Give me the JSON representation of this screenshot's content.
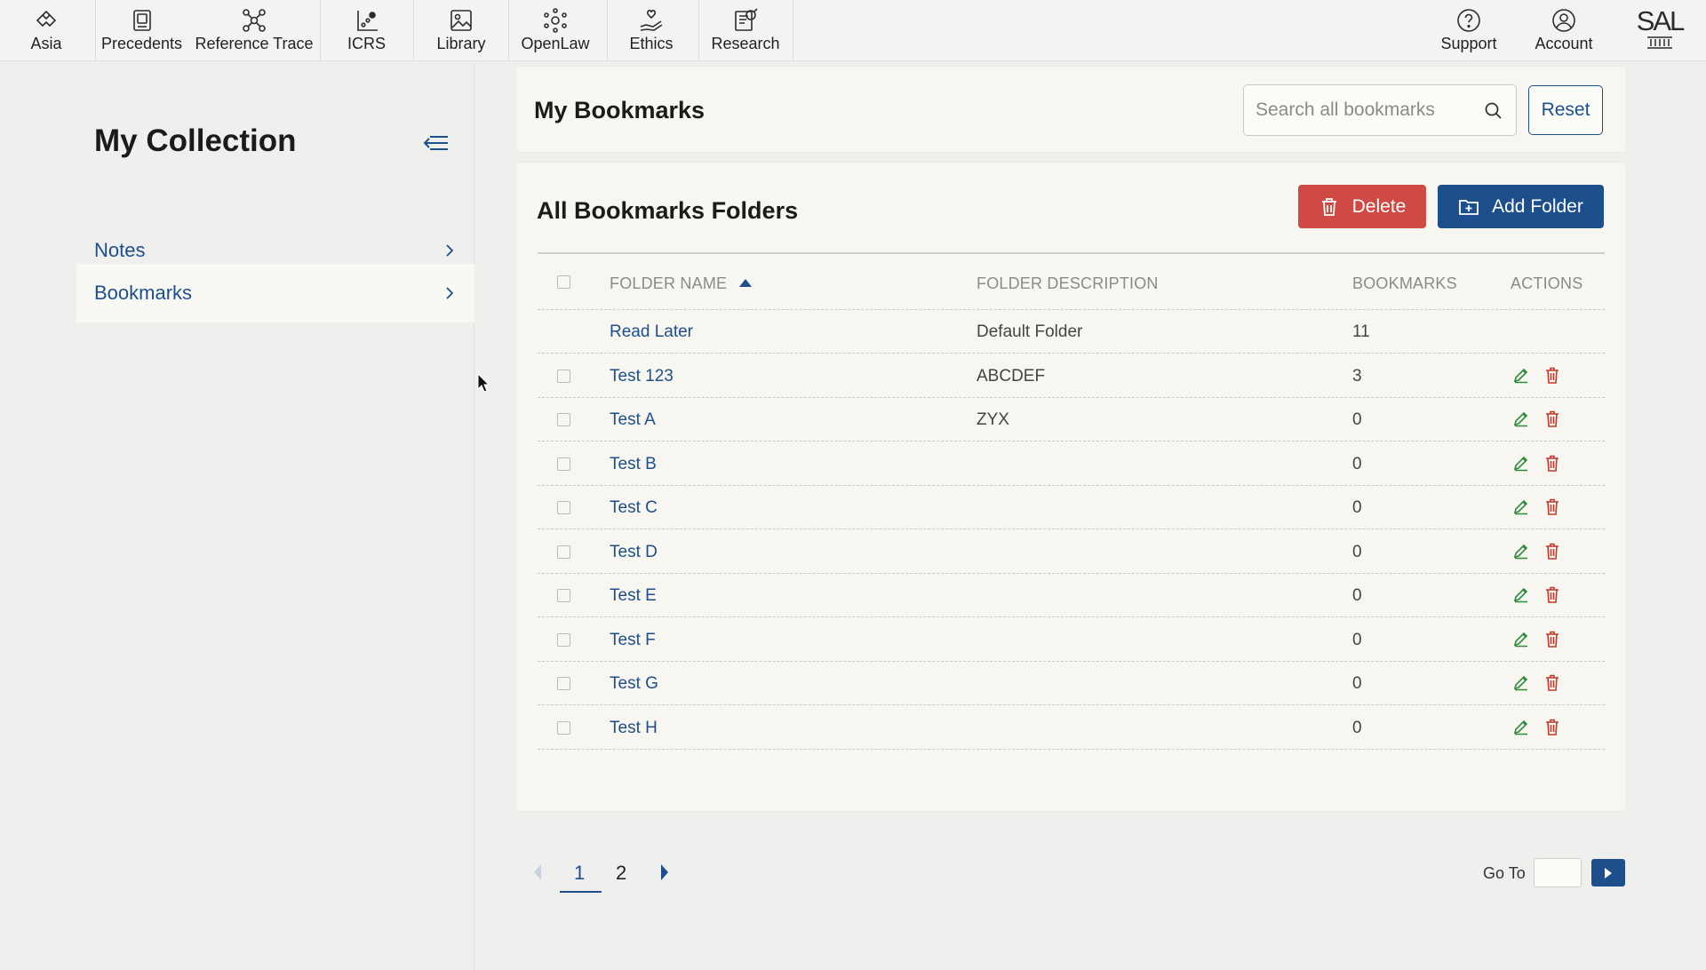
{
  "nav": {
    "items": [
      {
        "label": "Asia",
        "icon": "asia-icon"
      },
      {
        "label": "Precedents",
        "icon": "precedents-icon"
      },
      {
        "label": "Reference Trace",
        "icon": "reference-trace-icon"
      },
      {
        "label": "ICRS",
        "icon": "icrs-icon"
      },
      {
        "label": "Library",
        "icon": "library-icon"
      },
      {
        "label": "OpenLaw",
        "icon": "openlaw-icon"
      },
      {
        "label": "Ethics",
        "icon": "ethics-icon"
      },
      {
        "label": "Research",
        "icon": "research-icon"
      }
    ],
    "right": [
      {
        "label": "Support",
        "icon": "support-icon"
      },
      {
        "label": "Account",
        "icon": "account-icon"
      }
    ],
    "logo": "SAL"
  },
  "sidebar": {
    "title": "My Collection",
    "items": [
      {
        "label": "Notes"
      },
      {
        "label": "Bookmarks"
      }
    ]
  },
  "header": {
    "title": "My Bookmarks",
    "search_placeholder": "Search all bookmarks",
    "reset_label": "Reset"
  },
  "table": {
    "title": "All Bookmarks Folders",
    "delete_label": "Delete",
    "add_folder_label": "Add Folder",
    "columns": [
      "FOLDER NAME",
      "FOLDER DESCRIPTION",
      "BOOKMARKS",
      "ACTIONS"
    ],
    "rows": [
      {
        "name": "Read Later",
        "description": "Default Folder",
        "bookmarks": "11"
      },
      {
        "name": "Test 123",
        "description": "ABCDEF",
        "bookmarks": "3"
      },
      {
        "name": "Test A",
        "description": "ZYX",
        "bookmarks": "0"
      },
      {
        "name": "Test B",
        "description": "",
        "bookmarks": "0"
      },
      {
        "name": "Test C",
        "description": "",
        "bookmarks": "0"
      },
      {
        "name": "Test D",
        "description": "",
        "bookmarks": "0"
      },
      {
        "name": "Test E",
        "description": "",
        "bookmarks": "0"
      },
      {
        "name": "Test F",
        "description": "",
        "bookmarks": "0"
      },
      {
        "name": "Test G",
        "description": "",
        "bookmarks": "0"
      },
      {
        "name": "Test H",
        "description": "",
        "bookmarks": "0"
      }
    ]
  },
  "pagination": {
    "pages": [
      "1",
      "2"
    ],
    "current": "1",
    "goto_label": "Go To"
  },
  "colors": {
    "accent": "#1d4f8c",
    "danger": "#cf4a44",
    "edit": "#2e8b3a",
    "trash": "#c0392b"
  }
}
